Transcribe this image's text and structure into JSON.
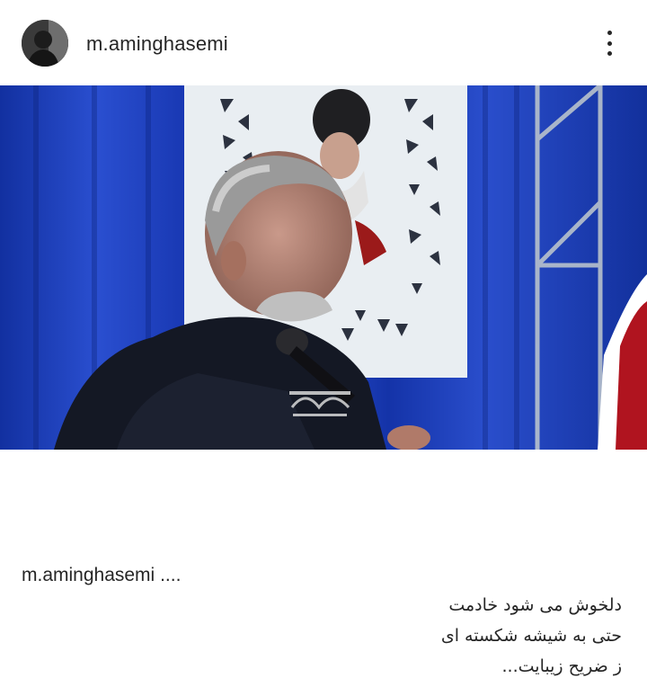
{
  "post": {
    "username": "m.aminghasemi",
    "caption_user": "m.aminghasemi",
    "caption_ellipsis": "....",
    "caption_lines": [
      "دلخوش می شود خادمت",
      "حتی به شیشه شکسته ای",
      "ز ضریح زیبایت..."
    ]
  },
  "icons": {
    "more": "more-vertical-icon"
  }
}
